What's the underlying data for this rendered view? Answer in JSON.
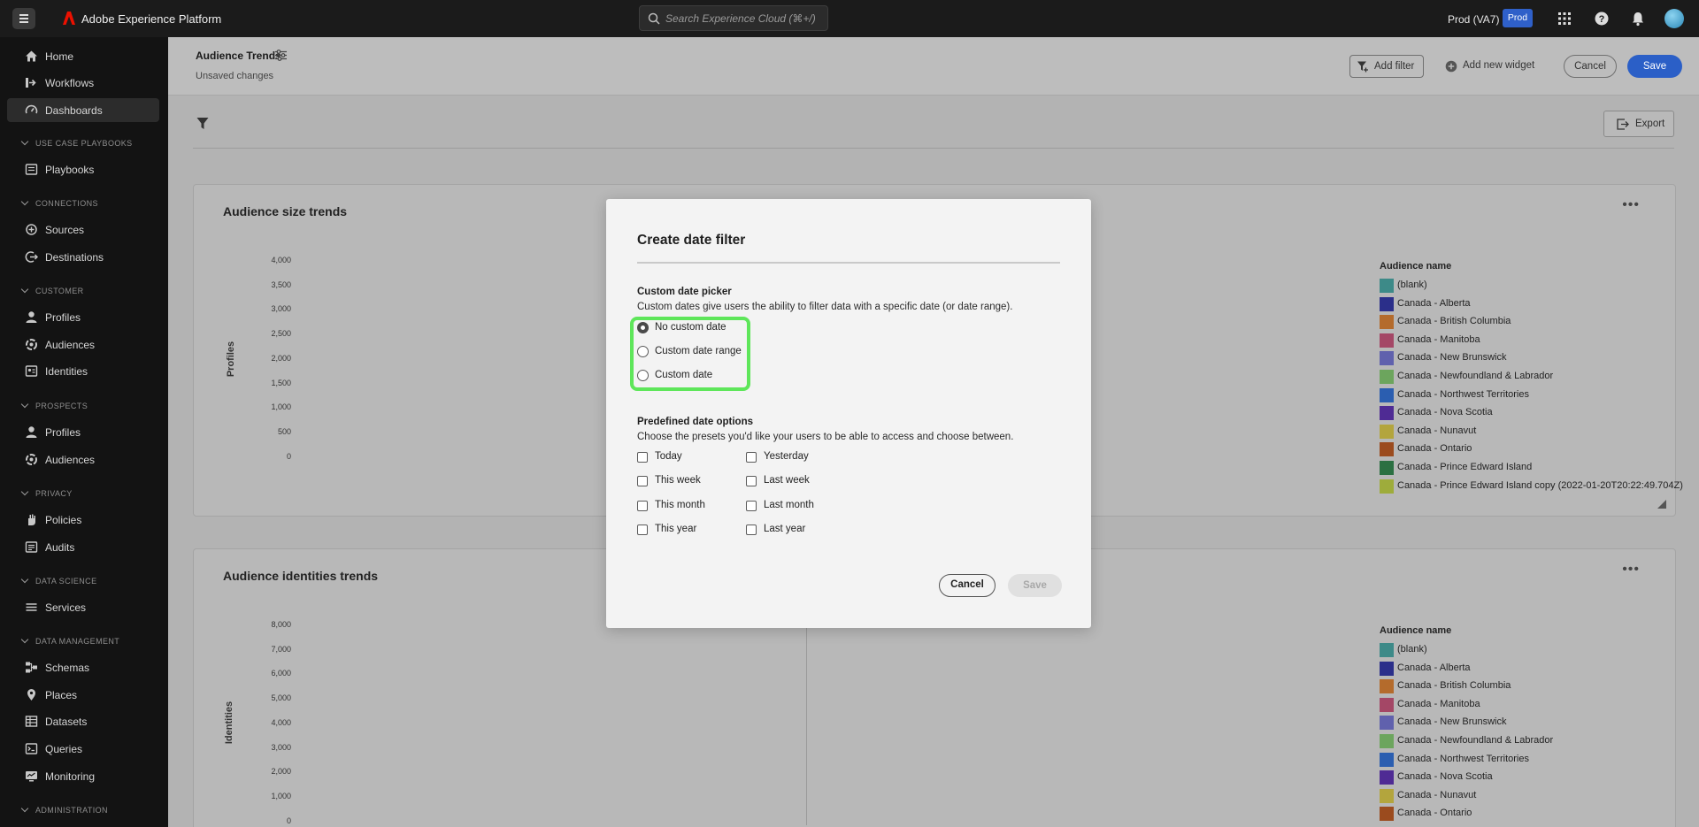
{
  "app": {
    "title": "Adobe Experience Platform",
    "search_placeholder": "Search Experience Cloud (⌘+/)",
    "org": "Prod (VA7)",
    "sandbox_badge": "Prod"
  },
  "sidebar": {
    "home": "Home",
    "workflows": "Workflows",
    "dashboards": "Dashboards",
    "sec_playbooks": "USE CASE PLAYBOOKS",
    "playbooks": "Playbooks",
    "sec_connections": "CONNECTIONS",
    "sources": "Sources",
    "destinations": "Destinations",
    "sec_customer": "CUSTOMER",
    "profiles": "Profiles",
    "audiences": "Audiences",
    "identities": "Identities",
    "sec_prospects": "PROSPECTS",
    "p_profiles": "Profiles",
    "p_audiences": "Audiences",
    "sec_privacy": "PRIVACY",
    "policies": "Policies",
    "audits": "Audits",
    "sec_datascience": "DATA SCIENCE",
    "services": "Services",
    "sec_datamgmt": "DATA MANAGEMENT",
    "schemas": "Schemas",
    "places": "Places",
    "datasets": "Datasets",
    "queries": "Queries",
    "monitoring": "Monitoring",
    "sec_admin": "ADMINISTRATION"
  },
  "header": {
    "title": "Audience Trends",
    "subtitle": "Unsaved changes",
    "add_filter": "Add filter",
    "add_widget": "Add new widget",
    "cancel": "Cancel",
    "save": "Save"
  },
  "toolbar": {
    "export": "Export"
  },
  "widgets": [
    {
      "title": "Audience size trends",
      "y_label": "Profiles",
      "y_ticks": [
        "4,000",
        "3,500",
        "3,000",
        "2,500",
        "2,000",
        "1,500",
        "1,000",
        "500",
        "0"
      ],
      "legend_title": "Audience name",
      "legend": [
        "(blank)",
        "Canada - Alberta",
        "Canada - British Columbia",
        "Canada - Manitoba",
        "Canada - New Brunswick",
        "Canada - Newfoundland & Labrador",
        "Canada - Northwest Territories",
        "Canada - Nova Scotia",
        "Canada - Nunavut",
        "Canada - Ontario",
        "Canada - Prince Edward Island",
        "Canada - Prince Edward Island copy (2022-01-20T20:22:49.704Z)"
      ]
    },
    {
      "title": "Audience identities trends",
      "y_label": "Identities",
      "y_ticks": [
        "8,000",
        "7,000",
        "6,000",
        "5,000",
        "4,000",
        "3,000",
        "2,000",
        "1,000",
        "0"
      ],
      "legend_title": "Audience name",
      "legend": [
        "(blank)",
        "Canada - Alberta",
        "Canada - British Columbia",
        "Canada - Manitoba",
        "Canada - New Brunswick",
        "Canada - Newfoundland & Labrador",
        "Canada - Northwest Territories",
        "Canada - Nova Scotia",
        "Canada - Nunavut",
        "Canada - Ontario"
      ]
    }
  ],
  "legend_colors": [
    "#3d8a88",
    "#2b2f8a",
    "#b46b2c",
    "#a44766",
    "#6061ad",
    "#6ca55d",
    "#2b5eb0",
    "#4f2b94",
    "#b3a53d",
    "#9b4b1e",
    "#2b7042",
    "#9eac3b"
  ],
  "modal": {
    "title": "Create date filter",
    "custom_heading": "Custom date picker",
    "custom_desc": "Custom dates give users the ability to filter data with a specific date (or date range).",
    "radios": [
      "No custom date",
      "Custom date range",
      "Custom date"
    ],
    "selected_radio": "No custom date",
    "predefined_heading": "Predefined date options",
    "predefined_desc": "Choose the presets you'd like your users to be able to access and choose between.",
    "options_left": [
      "Today",
      "This week",
      "This month",
      "This year"
    ],
    "options_right": [
      "Yesterday",
      "Last week",
      "Last month",
      "Last year"
    ],
    "cancel": "Cancel",
    "save": "Save"
  },
  "colors": {
    "accent": "#2b5fc7",
    "highlight": "#5ee65a"
  }
}
